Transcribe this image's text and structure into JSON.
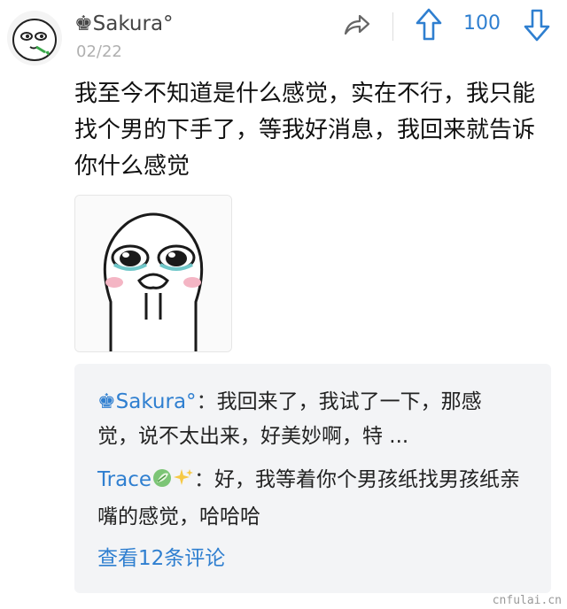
{
  "post": {
    "author": "♚Sakura°",
    "date": "02/22",
    "votes": "100",
    "text": "我至今不知道是什么感觉，实在不行，我只能找个男的下手了，等我好消息，我回来就告诉你什么感觉",
    "icons": {
      "avatar": "doodle-face-avatar",
      "share": "share-arrow-icon",
      "upvote": "arrow-up-icon",
      "downvote": "arrow-down-icon",
      "sticker": "crying-face-sticker"
    }
  },
  "comments": {
    "items": [
      {
        "user": "♚Sakura°",
        "sep": "：",
        "text": "我回来了，我试了一下，那感觉，说不太出来，好美妙啊，特 ..."
      },
      {
        "user": "Trace",
        "sep": "：",
        "text": "好，我等着你个男孩纸找男孩纸亲嘴的感觉，哈哈哈",
        "emojis": [
          "leaf-emoji",
          "sparkles-emoji"
        ]
      }
    ],
    "more_label": "查看12条评论"
  },
  "watermark": "cnfulai.cn",
  "colors": {
    "accent": "#2f7fd0",
    "muted": "#b0b0b0",
    "comment_bg": "#f3f4f6"
  }
}
